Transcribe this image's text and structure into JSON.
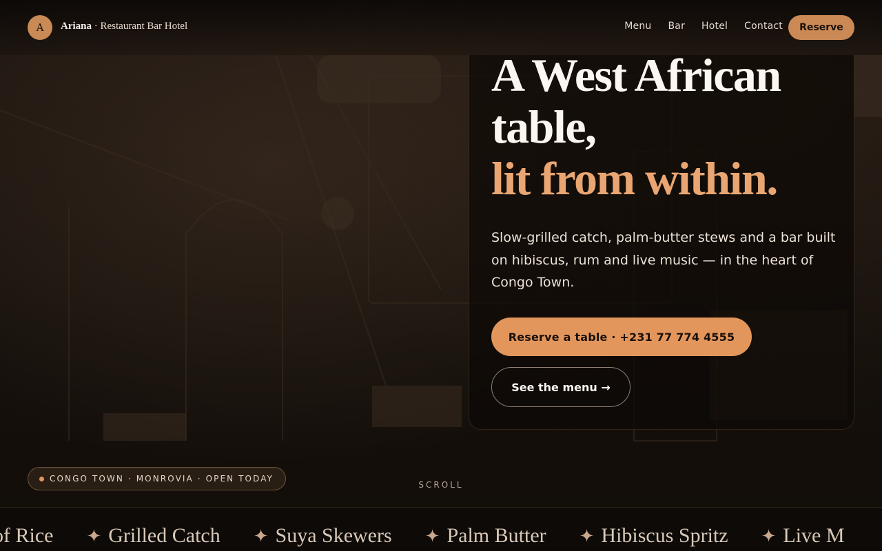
{
  "header": {
    "logo_letter": "A",
    "brand_name": "Ariana",
    "brand_tagline": " · Restaurant Bar Hotel",
    "nav": [
      "Menu",
      "Bar",
      "Hotel",
      "Contact"
    ],
    "reserve_label": "Reserve"
  },
  "hero": {
    "headline_line1": "A West African",
    "headline_line2": "table,",
    "headline_accent": "lit from within.",
    "subtitle": "Slow-grilled catch, palm-butter stews and a bar built on hibiscus, rum and live music — in the heart of Congo Town.",
    "cta_primary": "Reserve a table · +231 77 774 4555",
    "cta_secondary": "See the menu →"
  },
  "location_pill": "CONGO TOWN · MONROVIA · OPEN TODAY",
  "scroll_label": "SCROLL",
  "marquee": {
    "items": [
      "of Rice",
      "Grilled Catch",
      "Suya Skewers",
      "Palm Butter",
      "Hibiscus Spritz",
      "Live M"
    ],
    "star_icon": "✦"
  },
  "colors": {
    "accent": "#e3965c",
    "accent_text": "#e9a672",
    "background": "#120d09"
  }
}
